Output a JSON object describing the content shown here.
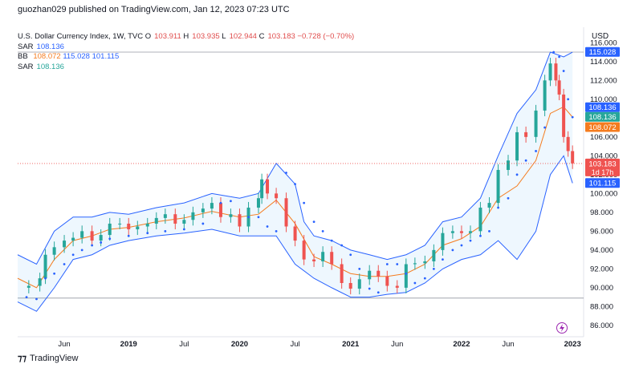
{
  "header": {
    "published": "guozhan029 published on TradingView.com, Jan 12, 2023 07:23 UTC"
  },
  "legend": {
    "symbol": "U.S. Dollar Currency Index, 1W, TVC",
    "o_label": "O",
    "o_value": "103.911",
    "h_label": "H",
    "h_value": "103.935",
    "l_label": "L",
    "l_value": "102.944",
    "c_label": "C",
    "c_value": "103.183",
    "change": "−0.728 (−0.70%)",
    "sar1_label": "SAR",
    "sar1_value": "108.136",
    "bb_label": "BB",
    "bb_mid": "108.072",
    "bb_upper": "115.028",
    "bb_lower": "101.115",
    "sar2_label": "SAR",
    "sar2_value": "108.136"
  },
  "footer": {
    "brand": "TradingView"
  },
  "colors": {
    "up": "#26a69a",
    "down": "#ef5350",
    "bb_band": "#2962ff",
    "bb_mid": "#f57c1f",
    "sar": "#2962ff",
    "price_line": "#ef5350"
  },
  "chart_data": {
    "type": "candlestick",
    "currency": "USD",
    "ylim": [
      84.8,
      117.3
    ],
    "y_ticks": [
      86,
      88,
      90,
      92,
      94,
      96,
      98,
      100,
      102,
      104,
      106,
      108,
      110,
      112,
      114,
      116
    ],
    "y_tick_labels": [
      "86.000",
      "88.000",
      "90.000",
      "92.000",
      "94.000",
      "96.000",
      "98.000",
      "100.000",
      "102.000",
      "104.000",
      "106.000",
      "108.000",
      "110.000",
      "112.000",
      "114.000",
      "116.000"
    ],
    "x_ticks": [
      {
        "t": 2018.42,
        "label": "Jun"
      },
      {
        "t": 2019.0,
        "label": "2019"
      },
      {
        "t": 2019.5,
        "label": "Jul"
      },
      {
        "t": 2020.0,
        "label": "2020"
      },
      {
        "t": 2020.5,
        "label": "Jul"
      },
      {
        "t": 2021.0,
        "label": "2021"
      },
      {
        "t": 2021.42,
        "label": "Jun"
      },
      {
        "t": 2022.0,
        "label": "2022"
      },
      {
        "t": 2022.42,
        "label": "Jun"
      },
      {
        "t": 2023.0,
        "label": "2023"
      }
    ],
    "x_range": [
      2018.0,
      2023.1
    ],
    "price_series": [
      [
        2018.0,
        90.0
      ],
      [
        2018.1,
        90.2
      ],
      [
        2018.2,
        91.0
      ],
      [
        2018.25,
        93.5
      ],
      [
        2018.33,
        94.3
      ],
      [
        2018.42,
        95.0
      ],
      [
        2018.5,
        95.3
      ],
      [
        2018.58,
        96.0
      ],
      [
        2018.67,
        95.0
      ],
      [
        2018.75,
        95.6
      ],
      [
        2018.83,
        96.8
      ],
      [
        2018.92,
        96.8
      ],
      [
        2019.0,
        96.2
      ],
      [
        2019.08,
        96.5
      ],
      [
        2019.17,
        96.8
      ],
      [
        2019.25,
        97.4
      ],
      [
        2019.33,
        97.8
      ],
      [
        2019.42,
        96.8
      ],
      [
        2019.5,
        97.2
      ],
      [
        2019.58,
        98.0
      ],
      [
        2019.67,
        98.4
      ],
      [
        2019.75,
        99.0
      ],
      [
        2019.83,
        97.5
      ],
      [
        2019.92,
        97.8
      ],
      [
        2020.0,
        96.5
      ],
      [
        2020.08,
        98.5
      ],
      [
        2020.17,
        99.5
      ],
      [
        2020.2,
        101.5
      ],
      [
        2020.25,
        100.0
      ],
      [
        2020.33,
        99.5
      ],
      [
        2020.42,
        96.5
      ],
      [
        2020.5,
        95.0
      ],
      [
        2020.58,
        93.0
      ],
      [
        2020.67,
        92.8
      ],
      [
        2020.75,
        93.8
      ],
      [
        2020.83,
        92.5
      ],
      [
        2020.92,
        90.5
      ],
      [
        2021.0,
        89.9
      ],
      [
        2021.08,
        90.9
      ],
      [
        2021.17,
        91.8
      ],
      [
        2021.25,
        91.2
      ],
      [
        2021.33,
        90.2
      ],
      [
        2021.42,
        90.0
      ],
      [
        2021.5,
        92.5
      ],
      [
        2021.58,
        92.6
      ],
      [
        2021.67,
        92.8
      ],
      [
        2021.75,
        94.0
      ],
      [
        2021.83,
        95.8
      ],
      [
        2021.92,
        96.0
      ],
      [
        2022.0,
        95.8
      ],
      [
        2022.08,
        96.0
      ],
      [
        2022.17,
        98.5
      ],
      [
        2022.25,
        99.0
      ],
      [
        2022.33,
        102.5
      ],
      [
        2022.42,
        103.5
      ],
      [
        2022.5,
        106.5
      ],
      [
        2022.58,
        106.0
      ],
      [
        2022.67,
        108.8
      ],
      [
        2022.75,
        112.0
      ],
      [
        2022.8,
        113.8
      ],
      [
        2022.85,
        112.0
      ],
      [
        2022.88,
        110.5
      ],
      [
        2022.92,
        106.0
      ],
      [
        2022.96,
        104.5
      ],
      [
        2023.0,
        103.2
      ]
    ],
    "upper_band": [
      [
        2018.0,
        93.5
      ],
      [
        2018.17,
        92.5
      ],
      [
        2018.33,
        96.0
      ],
      [
        2018.5,
        97.5
      ],
      [
        2018.67,
        97.5
      ],
      [
        2018.83,
        98.0
      ],
      [
        2019.0,
        97.8
      ],
      [
        2019.25,
        98.5
      ],
      [
        2019.5,
        99.0
      ],
      [
        2019.75,
        100.0
      ],
      [
        2020.0,
        99.5
      ],
      [
        2020.17,
        100.0
      ],
      [
        2020.33,
        103.2
      ],
      [
        2020.5,
        101.0
      ],
      [
        2020.58,
        97.0
      ],
      [
        2020.67,
        95.5
      ],
      [
        2020.83,
        95.0
      ],
      [
        2021.0,
        94.0
      ],
      [
        2021.17,
        93.5
      ],
      [
        2021.33,
        93.0
      ],
      [
        2021.5,
        93.5
      ],
      [
        2021.67,
        94.5
      ],
      [
        2021.83,
        97.0
      ],
      [
        2022.0,
        97.5
      ],
      [
        2022.17,
        99.5
      ],
      [
        2022.33,
        104.0
      ],
      [
        2022.5,
        108.5
      ],
      [
        2022.67,
        111.0
      ],
      [
        2022.8,
        115.0
      ],
      [
        2022.92,
        114.5
      ],
      [
        2023.0,
        115.0
      ]
    ],
    "lower_band": [
      [
        2018.0,
        88.5
      ],
      [
        2018.17,
        87.5
      ],
      [
        2018.33,
        90.0
      ],
      [
        2018.5,
        93.0
      ],
      [
        2018.67,
        93.5
      ],
      [
        2018.83,
        94.5
      ],
      [
        2019.0,
        95.0
      ],
      [
        2019.25,
        95.5
      ],
      [
        2019.5,
        95.8
      ],
      [
        2019.75,
        96.2
      ],
      [
        2020.0,
        95.5
      ],
      [
        2020.17,
        95.5
      ],
      [
        2020.33,
        95.5
      ],
      [
        2020.5,
        92.5
      ],
      [
        2020.67,
        91.0
      ],
      [
        2020.83,
        90.0
      ],
      [
        2021.0,
        89.0
      ],
      [
        2021.17,
        89.0
      ],
      [
        2021.33,
        89.3
      ],
      [
        2021.5,
        89.5
      ],
      [
        2021.67,
        90.5
      ],
      [
        2021.83,
        92.0
      ],
      [
        2022.0,
        93.0
      ],
      [
        2022.17,
        93.5
      ],
      [
        2022.33,
        95.0
      ],
      [
        2022.5,
        93.0
      ],
      [
        2022.67,
        96.0
      ],
      [
        2022.8,
        102.0
      ],
      [
        2022.92,
        104.0
      ],
      [
        2023.0,
        101.1
      ]
    ],
    "middle_band": [
      [
        2018.0,
        91.0
      ],
      [
        2018.17,
        90.0
      ],
      [
        2018.33,
        93.0
      ],
      [
        2018.5,
        95.0
      ],
      [
        2018.67,
        95.5
      ],
      [
        2018.83,
        96.2
      ],
      [
        2019.0,
        96.4
      ],
      [
        2019.25,
        97.0
      ],
      [
        2019.5,
        97.4
      ],
      [
        2019.75,
        98.1
      ],
      [
        2020.0,
        97.5
      ],
      [
        2020.17,
        97.8
      ],
      [
        2020.33,
        99.3
      ],
      [
        2020.5,
        96.8
      ],
      [
        2020.67,
        93.3
      ],
      [
        2020.83,
        92.5
      ],
      [
        2021.0,
        91.5
      ],
      [
        2021.17,
        91.2
      ],
      [
        2021.33,
        91.2
      ],
      [
        2021.5,
        91.5
      ],
      [
        2021.67,
        92.5
      ],
      [
        2021.83,
        94.5
      ],
      [
        2022.0,
        95.2
      ],
      [
        2022.17,
        96.5
      ],
      [
        2022.33,
        99.5
      ],
      [
        2022.5,
        100.8
      ],
      [
        2022.67,
        103.5
      ],
      [
        2022.8,
        108.5
      ],
      [
        2022.92,
        109.2
      ],
      [
        2023.0,
        108.1
      ]
    ],
    "sar_points": [
      [
        2018.08,
        89.0
      ],
      [
        2018.17,
        88.8
      ],
      [
        2018.25,
        91.0
      ],
      [
        2018.33,
        91.5
      ],
      [
        2018.42,
        92.5
      ],
      [
        2018.5,
        93.5
      ],
      [
        2018.58,
        94.0
      ],
      [
        2018.67,
        94.5
      ],
      [
        2018.75,
        94.8
      ],
      [
        2018.83,
        95.2
      ],
      [
        2019.0,
        95.5
      ],
      [
        2019.17,
        95.8
      ],
      [
        2019.33,
        96.0
      ],
      [
        2019.5,
        96.2
      ],
      [
        2019.67,
        96.8
      ],
      [
        2019.83,
        99.0
      ],
      [
        2019.92,
        99.2
      ],
      [
        2020.08,
        97.5
      ],
      [
        2020.17,
        97.5
      ],
      [
        2020.25,
        96.5
      ],
      [
        2020.33,
        96.0
      ],
      [
        2020.42,
        102.2
      ],
      [
        2020.5,
        101.0
      ],
      [
        2020.58,
        99.0
      ],
      [
        2020.67,
        97.0
      ],
      [
        2020.75,
        96.0
      ],
      [
        2020.83,
        95.0
      ],
      [
        2020.92,
        94.5
      ],
      [
        2021.0,
        93.5
      ],
      [
        2021.08,
        92.0
      ],
      [
        2021.17,
        89.9
      ],
      [
        2021.25,
        89.5
      ],
      [
        2021.33,
        92.5
      ],
      [
        2021.42,
        92.5
      ],
      [
        2021.5,
        91.5
      ],
      [
        2021.58,
        90.5
      ],
      [
        2021.67,
        91.0
      ],
      [
        2021.75,
        92.0
      ],
      [
        2021.83,
        93.0
      ],
      [
        2021.92,
        94.0
      ],
      [
        2022.0,
        94.5
      ],
      [
        2022.08,
        95.0
      ],
      [
        2022.17,
        95.5
      ],
      [
        2022.25,
        96.0
      ],
      [
        2022.33,
        98.5
      ],
      [
        2022.42,
        99.5
      ],
      [
        2022.5,
        102.0
      ],
      [
        2022.58,
        103.5
      ],
      [
        2022.67,
        104.5
      ],
      [
        2022.75,
        107.0
      ],
      [
        2022.83,
        115.0
      ],
      [
        2022.88,
        114.5
      ],
      [
        2022.92,
        113.0
      ],
      [
        2022.96,
        110.0
      ],
      [
        2023.0,
        108.1
      ]
    ],
    "last_price": 103.183,
    "last_price_labels": [
      "103.183",
      "1d 17h"
    ],
    "hline_top": 115.0,
    "hline_bottom": 88.9,
    "price_badges": [
      {
        "value": 115.028,
        "label": "115.028",
        "color": "#2962ff"
      },
      {
        "value": 108.136,
        "label": "108.136",
        "color": "#2962ff"
      },
      {
        "value": 108.136,
        "label": "108.136",
        "color": "#26a69a"
      },
      {
        "value": 108.072,
        "label": "108.072",
        "color": "#f57c1f"
      },
      {
        "value": 101.115,
        "label": "101.115",
        "color": "#2962ff"
      }
    ]
  }
}
